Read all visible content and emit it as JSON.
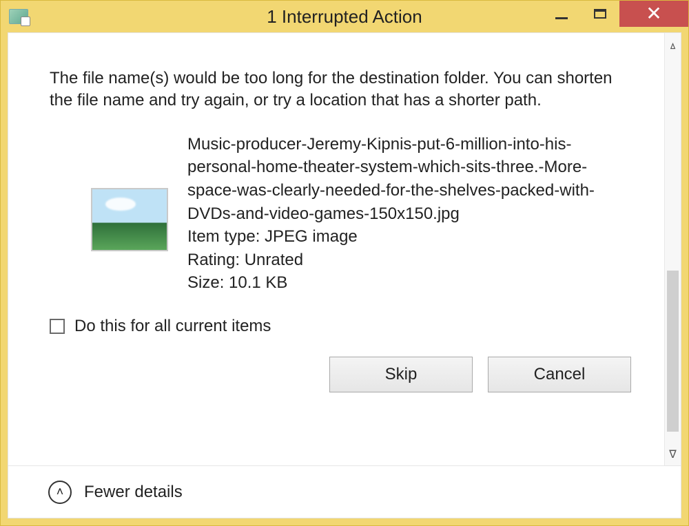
{
  "window": {
    "title": "1 Interrupted Action"
  },
  "message": "The file name(s) would be too long for the destination folder. You can shorten the file name and try again, or try a location that has a shorter path.",
  "file": {
    "name": "Music-producer-Jeremy-Kipnis-put-6-million-into-his-personal-home-theater-system-which-sits-three.-More-space-was-clearly-needed-for-the-shelves-packed-with-DVDs-and-video-games-150x150.jpg",
    "type_label": "Item type: JPEG image",
    "rating_label": "Rating: Unrated",
    "size_label": "Size: 10.1 KB"
  },
  "checkbox_label": "Do this for all current items",
  "buttons": {
    "skip": "Skip",
    "cancel": "Cancel"
  },
  "footer": {
    "toggle_label": "Fewer details"
  }
}
